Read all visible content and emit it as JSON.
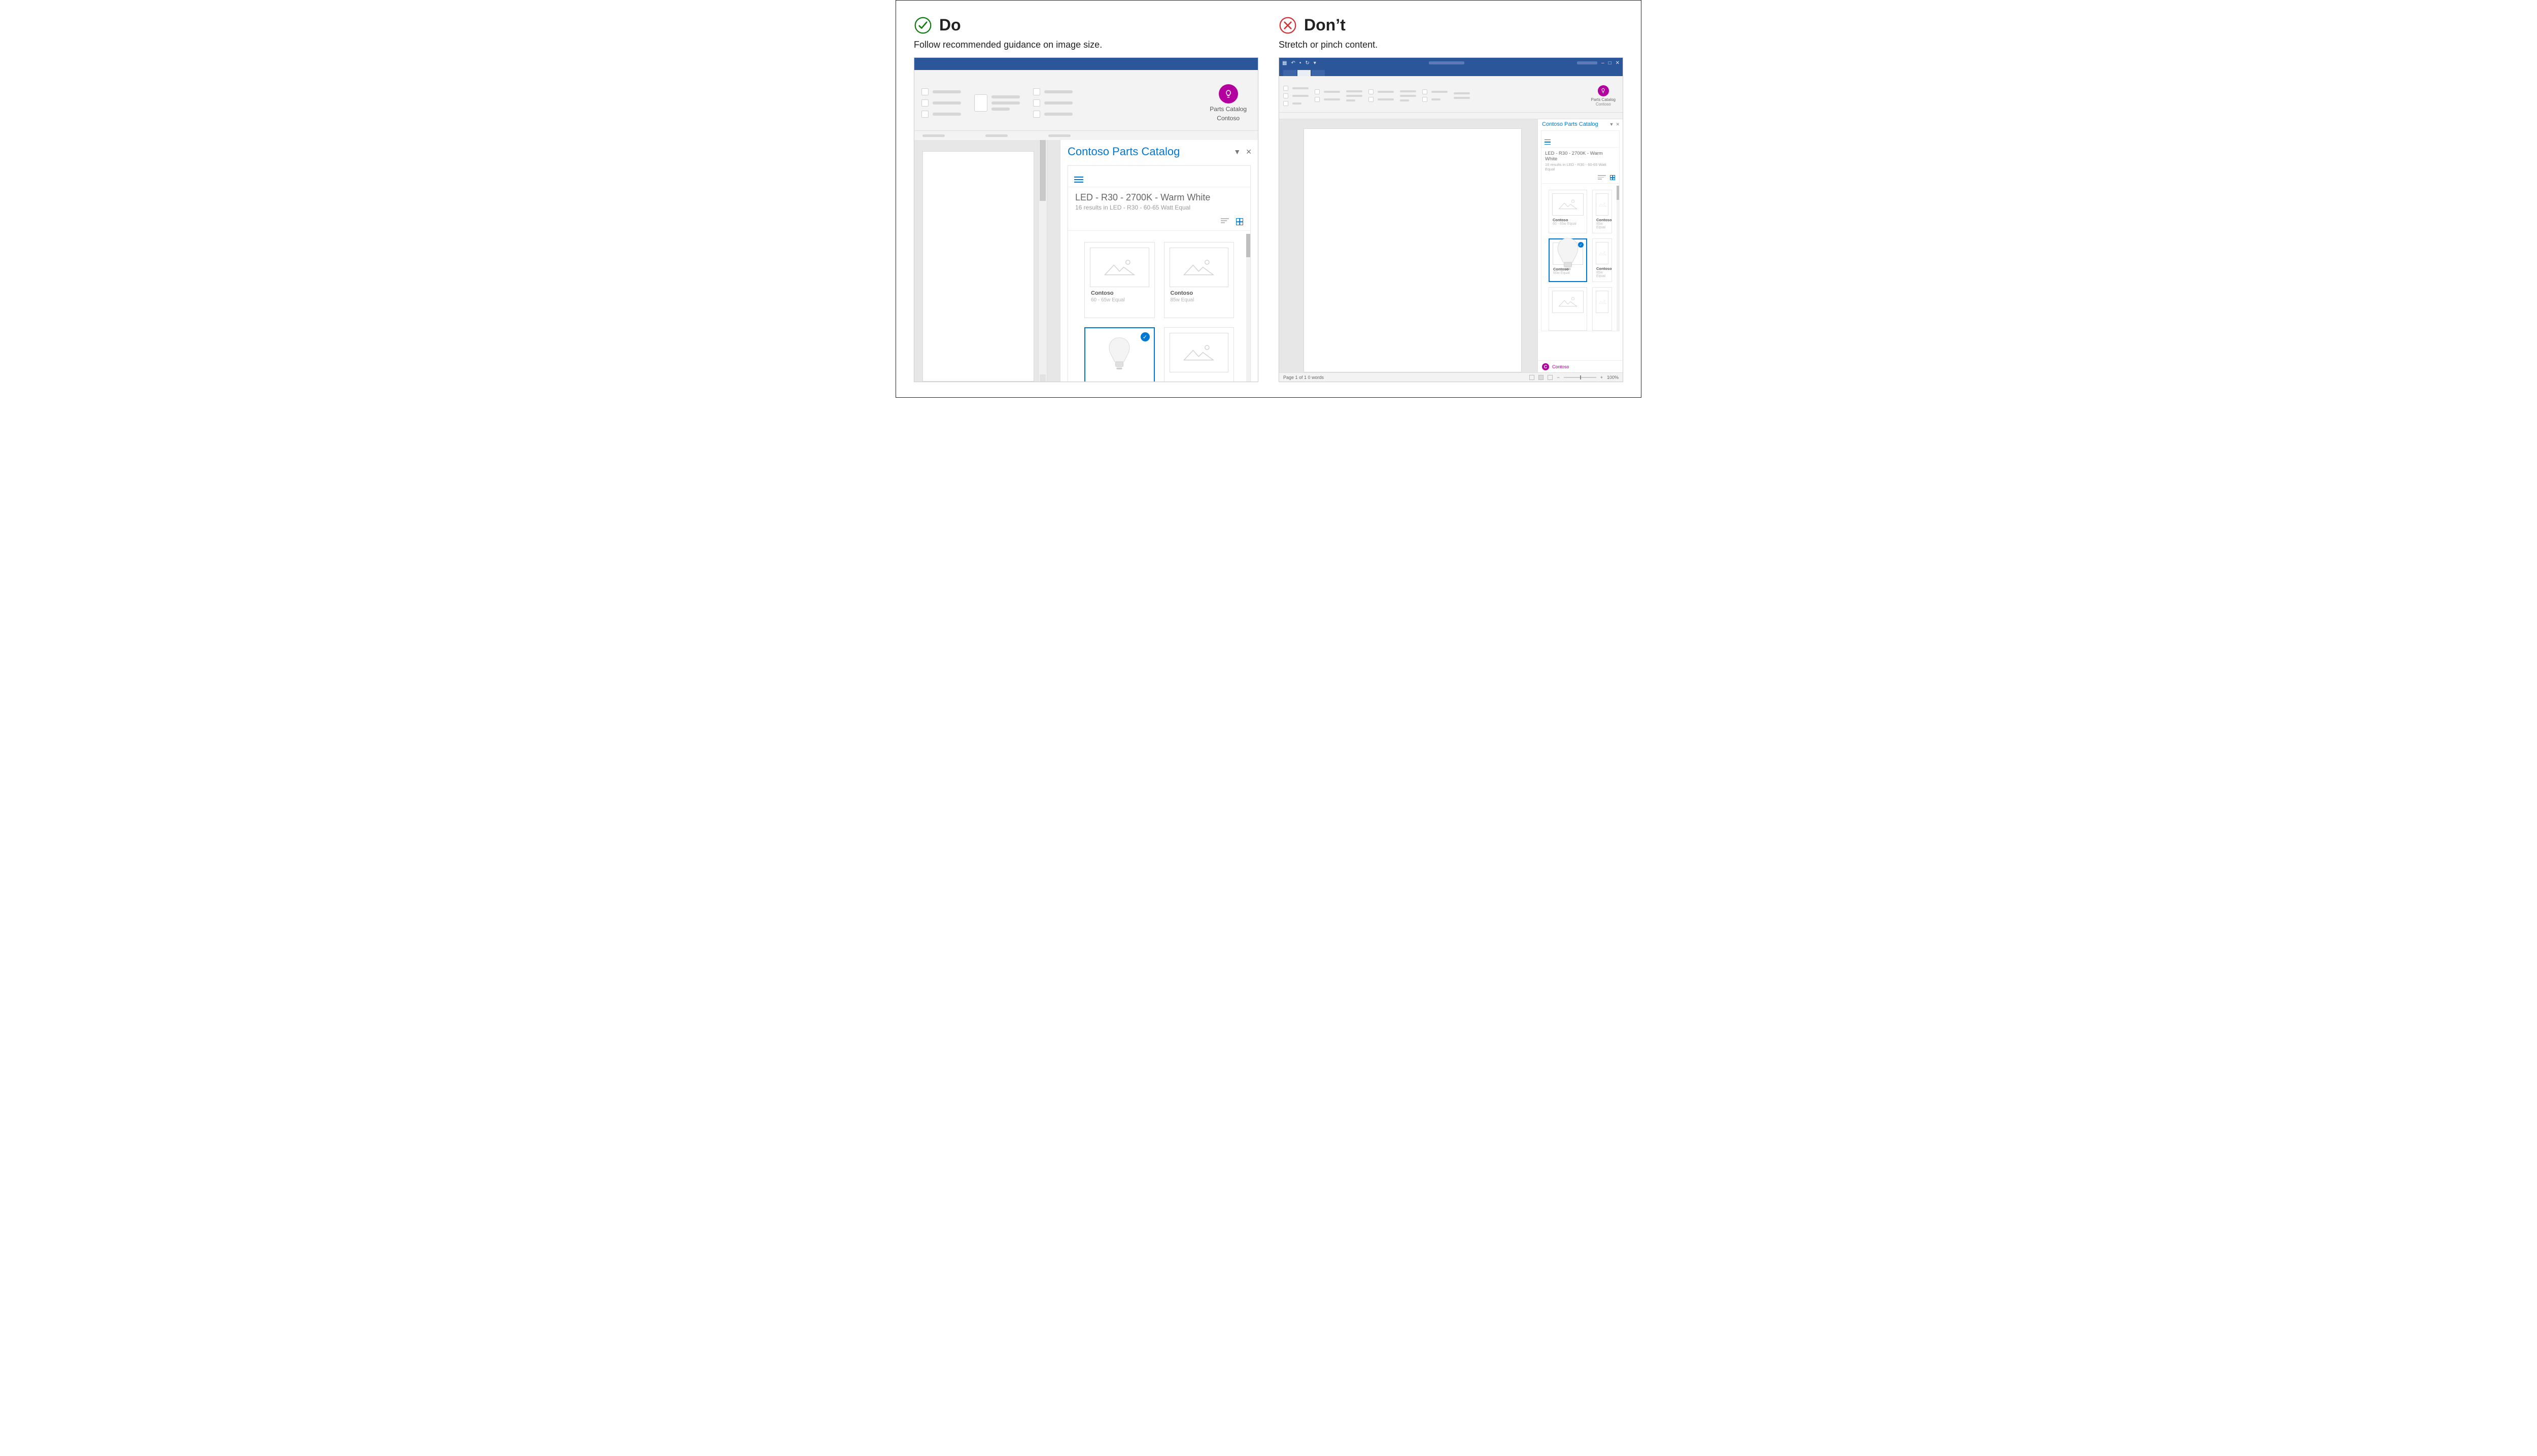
{
  "do": {
    "title": "Do",
    "subtitle": "Follow recommended guidance on image size.",
    "ribbon": {
      "catalog_line1": "Parts Catalog",
      "catalog_line2": "Contoso"
    },
    "pane": {
      "title": "Contoso Parts Catalog",
      "heading": "LED - R30 - 2700K - Warm White",
      "subheading": "16 results in LED - R30 - 60-65 Watt Equal",
      "tiles": [
        {
          "brand": "Contoso",
          "sub": "60 - 65w Equal",
          "selected": false,
          "img": "placeholder"
        },
        {
          "brand": "Contoso",
          "sub": "85w Equal",
          "selected": false,
          "img": "placeholder"
        },
        {
          "brand": "",
          "sub": "",
          "selected": true,
          "img": "bulb"
        },
        {
          "brand": "",
          "sub": "",
          "selected": false,
          "img": "placeholder"
        }
      ]
    }
  },
  "dont": {
    "title": "Don’t",
    "subtitle": "Stretch or pinch content.",
    "window": {
      "min": "–",
      "max": "□",
      "close": "✕"
    },
    "ribbon": {
      "catalog_line1": "Parts Catalog",
      "catalog_line2": "Contoso"
    },
    "pane": {
      "title": "Contoso Parts Catalog",
      "heading": "LED - R30 - 2700K - Warm White",
      "subheading": "16 results in LED - R30 - 60-65 Watt Equal",
      "tiles": [
        {
          "brand": "Contoso",
          "sub": "60 - 65w Equal",
          "selected": false,
          "img": "placeholder"
        },
        {
          "brand": "Contoso",
          "sub": "85w Equal",
          "selected": false,
          "img": "placeholder"
        },
        {
          "brand": "Contoso",
          "sub": "60w Equal",
          "selected": true,
          "img": "bulb"
        },
        {
          "brand": "Contoso",
          "sub": "85w Equal",
          "selected": false,
          "img": "placeholder"
        },
        {
          "brand": "",
          "sub": "",
          "selected": false,
          "img": "placeholder"
        },
        {
          "brand": "",
          "sub": "",
          "selected": false,
          "img": "placeholder"
        }
      ],
      "persona": {
        "initial": "C",
        "name": "Contoso"
      }
    },
    "status": {
      "left": "Page 1 of 1    0 words",
      "zoom": "100%"
    }
  }
}
